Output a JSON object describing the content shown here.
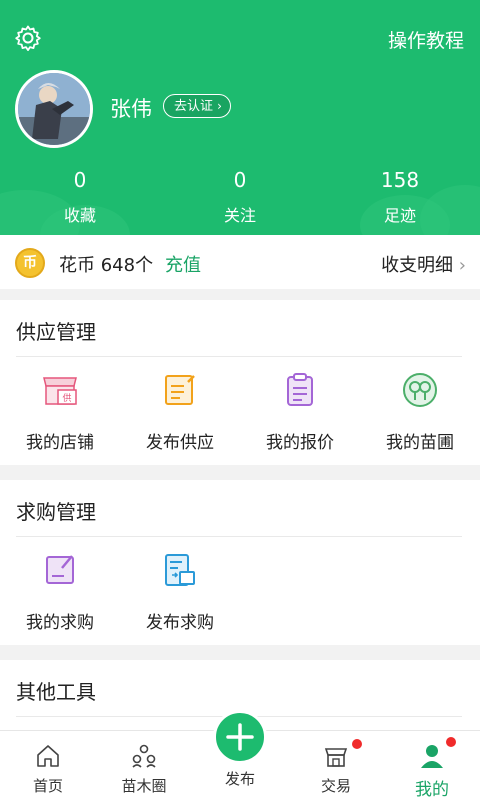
{
  "header": {
    "tutorial": "操作教程",
    "username": "张伟",
    "verify": "去认证",
    "stats": [
      {
        "value": "0",
        "label": "收藏"
      },
      {
        "value": "0",
        "label": "关注"
      },
      {
        "value": "158",
        "label": "足迹"
      }
    ]
  },
  "coins": {
    "icon_text": "币",
    "text": "花币 648个",
    "recharge": "充值",
    "ledger": "收支明细"
  },
  "supply": {
    "title": "供应管理",
    "items": [
      {
        "label": "我的店铺",
        "icon": "shop-icon"
      },
      {
        "label": "发布供应",
        "icon": "publish-supply-icon"
      },
      {
        "label": "我的报价",
        "icon": "quote-icon"
      },
      {
        "label": "我的苗圃",
        "icon": "nursery-icon"
      }
    ]
  },
  "purchase": {
    "title": "求购管理",
    "items": [
      {
        "label": "我的求购",
        "icon": "my-purchase-icon"
      },
      {
        "label": "发布求购",
        "icon": "publish-purchase-icon"
      }
    ]
  },
  "other": {
    "title": "其他工具"
  },
  "nav": {
    "items": [
      {
        "label": "首页",
        "icon": "home-icon"
      },
      {
        "label": "苗木圈",
        "icon": "community-icon"
      },
      {
        "label": "发布",
        "icon": "plus-icon"
      },
      {
        "label": "交易",
        "icon": "trade-icon"
      },
      {
        "label": "我的",
        "icon": "profile-icon"
      }
    ]
  },
  "colors": {
    "brand": "#1dbb6f",
    "accent_text": "#1aa466",
    "badge": "#f02b2b"
  }
}
